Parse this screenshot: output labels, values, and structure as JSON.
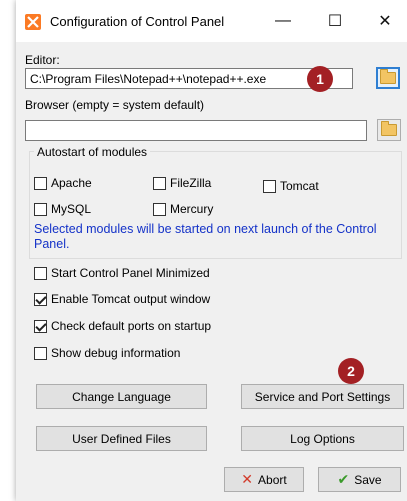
{
  "window": {
    "title": "Configuration of Control Panel",
    "minimize_glyph": "—",
    "maximize_glyph": "☐",
    "close_glyph": "✕"
  },
  "editor": {
    "label": "Editor:",
    "value": "C:\\Program Files\\Notepad++\\notepad++.exe"
  },
  "browser": {
    "label": "Browser (empty = system default)",
    "value": ""
  },
  "autostart": {
    "title": "Autostart of modules",
    "modules": [
      {
        "label": "Apache",
        "checked": false
      },
      {
        "label": "FileZilla",
        "checked": false
      },
      {
        "label": "Tomcat",
        "checked": false
      },
      {
        "label": "MySQL",
        "checked": false
      },
      {
        "label": "Mercury",
        "checked": false
      }
    ],
    "note": "Selected modules will be started on next launch of the Control Panel."
  },
  "options": [
    {
      "label": "Start Control Panel Minimized",
      "checked": false
    },
    {
      "label": "Enable Tomcat output window",
      "checked": true
    },
    {
      "label": "Check default ports on startup",
      "checked": true
    },
    {
      "label": "Show debug information",
      "checked": false
    }
  ],
  "buttons": {
    "change_language": "Change Language",
    "service_port_settings": "Service and Port Settings",
    "user_defined_files": "User Defined Files",
    "log_options": "Log Options",
    "abort": "Abort",
    "save": "Save"
  },
  "markers": [
    "1",
    "2"
  ],
  "colors": {
    "marker": "#a32024",
    "note_text": "#1432c8",
    "app_icon": "#fb7a24"
  }
}
